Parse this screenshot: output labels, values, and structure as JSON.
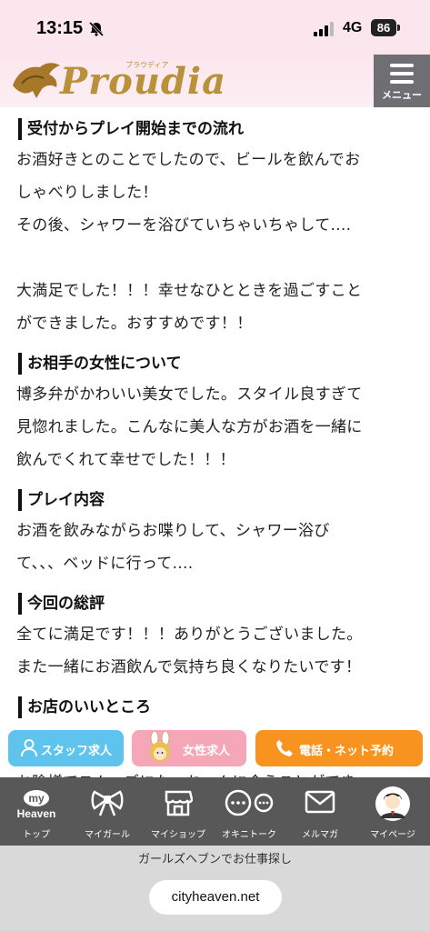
{
  "status_bar": {
    "time": "13:15",
    "network": "4G",
    "battery": "86"
  },
  "header": {
    "logo_text": "Proudia",
    "logo_kana": "プラウディア",
    "menu_label": "メニュー"
  },
  "sections": [
    {
      "title": "受付からプレイ開始までの流れ",
      "body": "お酒好きとのことでしたので、ビールを飲んでお\nしゃべりしました！\nその後、シャワーを浴びていちゃいちゃして....\n\n大満足でした！！！幸せなひとときを過ごすこと\nができました。おすすめです！！"
    },
    {
      "title": "お相手の女性について",
      "body": "博多弁がかわいい美女でした。スタイル良すぎて\n見惚れました。こんなに美人な方がお酒を一緒に\n飲んでくれて幸せでした！！！"
    },
    {
      "title": "プレイ内容",
      "body": "お酒を飲みながらお喋りして、シャワー浴び\nて、、、ベッドに行って...."
    },
    {
      "title": "今回の総評",
      "body": "全てに満足です！！！ありがとうございました。\nまた一緒にお酒飲んで気持ち良くなりたいです！"
    },
    {
      "title": "お店のいいところ",
      "body": ""
    }
  ],
  "overflow_text": "お陰様でスムーズになっちゃんに会うことができ",
  "actions": {
    "staff": "スタッフ求人",
    "female": "女性求人",
    "reserve": "電話・ネット予約"
  },
  "tabs": [
    {
      "label": "トップ",
      "badge_top": "my",
      "badge_bottom": "Heaven"
    },
    {
      "label": "マイガール"
    },
    {
      "label": "マイショップ"
    },
    {
      "label": "オキニトーク"
    },
    {
      "label": "メルマガ"
    },
    {
      "label": "マイページ"
    }
  ],
  "browser": {
    "hint": "ガールズヘブンでお仕事探し",
    "url": "cityheaven.net"
  }
}
